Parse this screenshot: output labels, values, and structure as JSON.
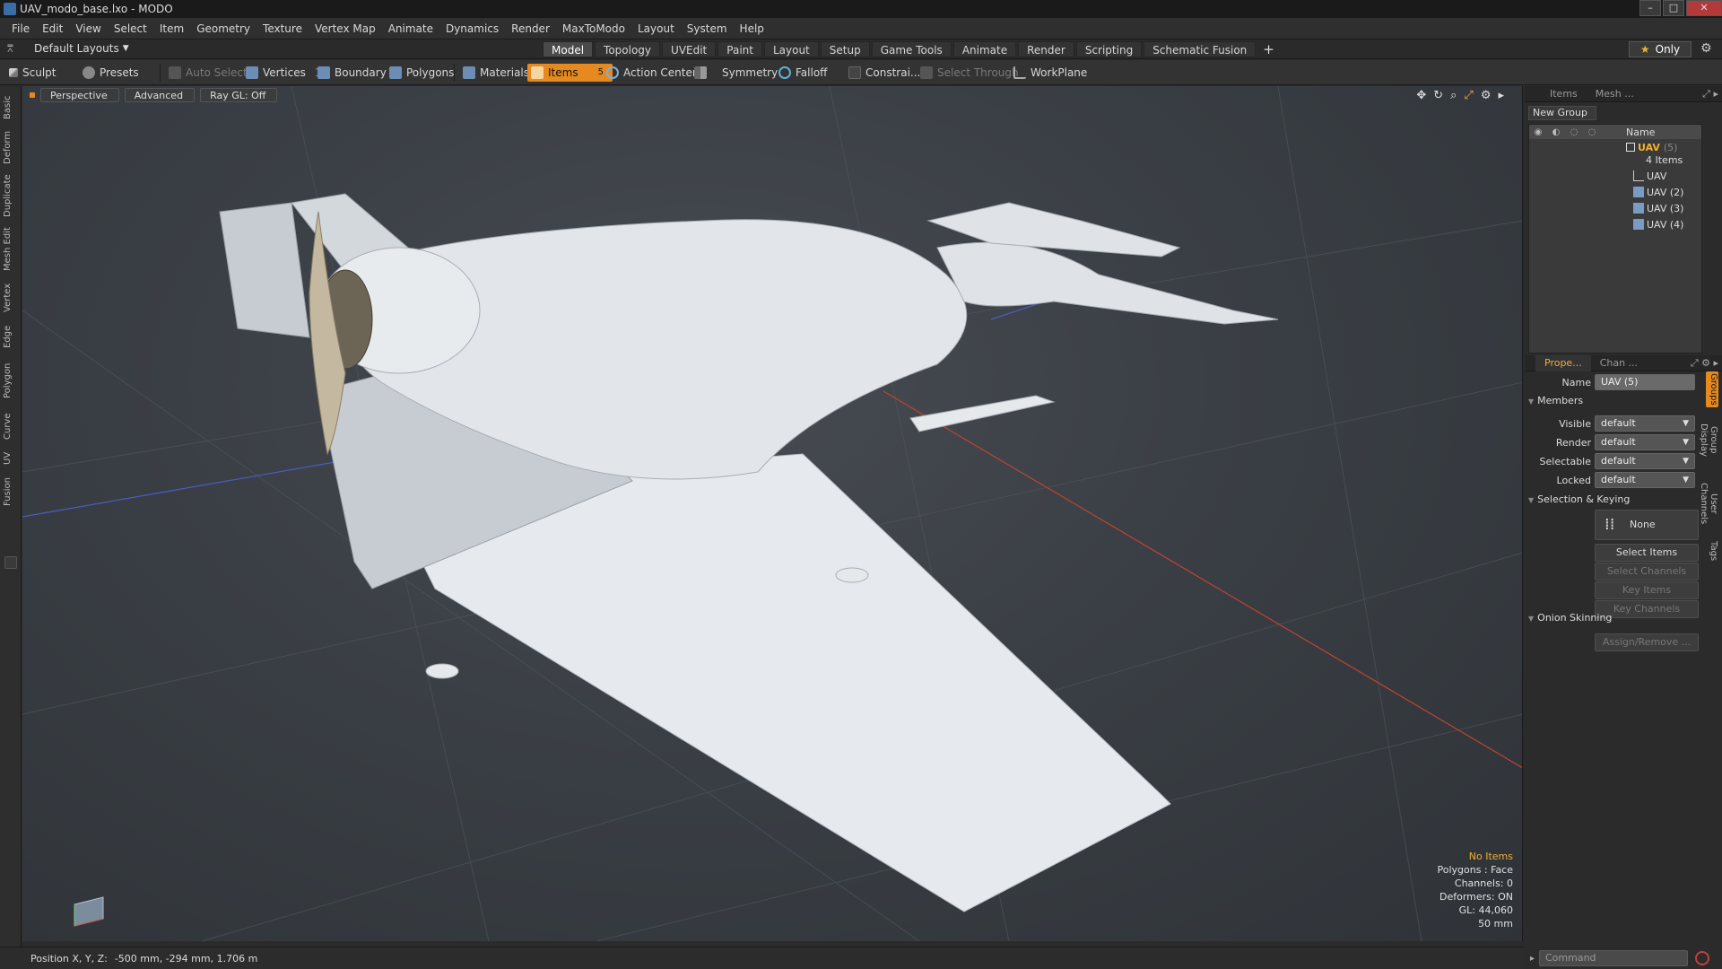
{
  "window": {
    "title": "UAV_modo_base.lxo - MODO",
    "controls": [
      "minimize",
      "maximize",
      "close"
    ]
  },
  "menubar": [
    "File",
    "Edit",
    "View",
    "Select",
    "Item",
    "Geometry",
    "Texture",
    "Vertex Map",
    "Animate",
    "Dynamics",
    "Render",
    "MaxToModo",
    "Layout",
    "System",
    "Help"
  ],
  "layout_selector": "Default Layouts",
  "tabs": [
    {
      "label": "Model",
      "active": true
    },
    {
      "label": "Topology"
    },
    {
      "label": "UVEdit"
    },
    {
      "label": "Paint"
    },
    {
      "label": "Layout"
    },
    {
      "label": "Setup"
    },
    {
      "label": "Game Tools"
    },
    {
      "label": "Animate"
    },
    {
      "label": "Render"
    },
    {
      "label": "Scripting"
    },
    {
      "label": "Schematic Fusion"
    }
  ],
  "only_button": "Only",
  "toolbar": {
    "sculpt": "Sculpt",
    "presets": "Presets",
    "auto_select": "Auto Select",
    "vertices": "Vertices",
    "boundary": "Boundary",
    "polygons": "Polygons",
    "materials": "Materials",
    "items": "Items",
    "action_center": "Action Center",
    "symmetry": "Symmetry",
    "falloff": "Falloff",
    "constraints": "Constrai...",
    "select_through": "Select Through",
    "workplane": "WorkPlane",
    "vertices_count": "1",
    "items_count": "5"
  },
  "left_tabs": [
    "Basic",
    "Deform",
    "Duplicate",
    "Mesh Edit",
    "Vertex",
    "Edge",
    "Polygon",
    "Curve",
    "UV",
    "Fusion"
  ],
  "viewport": {
    "view_mode": "Perspective",
    "shading": "Advanced",
    "raygl": "Ray GL: Off",
    "info": {
      "selection": "No Items",
      "polygons": "Polygons : Face",
      "channels": "Channels: 0",
      "deformers": "Deformers: ON",
      "gl": "GL: 44,060",
      "scale": "50 mm"
    }
  },
  "statusbar": {
    "label": "Position X, Y, Z:",
    "value": "-500 mm, -294 mm, 1.706 m"
  },
  "items_panel": {
    "tabs": [
      "Items",
      "Mesh ..."
    ],
    "new_group": "New Group",
    "name_header": "Name",
    "group": {
      "name": "UAV",
      "count": "(5)",
      "sub": "4 Items"
    },
    "children": [
      "UAV",
      "UAV (2)",
      "UAV (3)",
      "UAV (4)"
    ]
  },
  "properties_panel": {
    "tabs": [
      "Prope...",
      "Chan ..."
    ],
    "name_label": "Name",
    "name_value": "UAV (5)",
    "members_section": "Members",
    "visible_label": "Visible",
    "visible_value": "default",
    "render_label": "Render",
    "render_value": "default",
    "selectable_label": "Selectable",
    "selectable_value": "default",
    "locked_label": "Locked",
    "locked_value": "default",
    "keying_section": "Selection & Keying",
    "none_btn": "None",
    "select_items": "Select Items",
    "select_channels": "Select Channels",
    "key_items": "Key Items",
    "key_channels": "Key Channels",
    "onion_section": "Onion Skinning",
    "assign_remove": "Assign/Remove ..."
  },
  "side_tabs": [
    "Groups",
    "Group Display",
    "User Channels",
    "Tags"
  ],
  "command_placeholder": "Command",
  "colors": {
    "accent": "#e68a1f",
    "highlight": "#f0b030",
    "viewport_bg": "#3a3f45"
  }
}
